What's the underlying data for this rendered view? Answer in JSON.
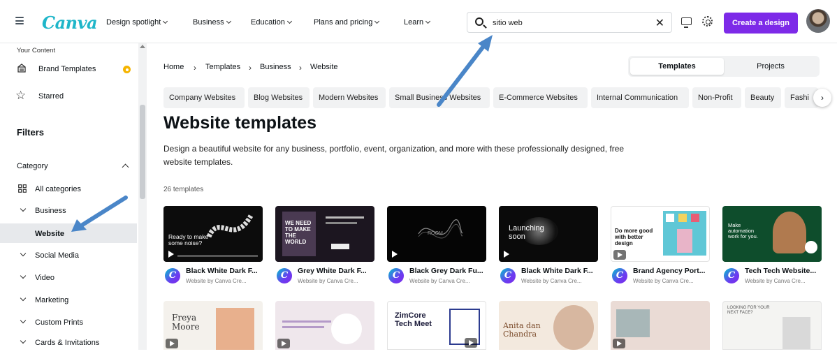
{
  "header": {
    "logo": "Canva",
    "nav": [
      "Design spotlight",
      "Business",
      "Education",
      "Plans and pricing",
      "Learn"
    ],
    "search_value": "sitio web",
    "create_label": "Create a design"
  },
  "sidebar": {
    "your_content": "Your Content",
    "brand_templates": "Brand Templates",
    "starred": "Starred",
    "filters": "Filters",
    "category": "Category",
    "all_categories": "All categories",
    "items": [
      "Business",
      "Website",
      "Social Media",
      "Video",
      "Marketing",
      "Custom Prints",
      "Cards & Invitations"
    ]
  },
  "breadcrumb": [
    "Home",
    "Templates",
    "Business",
    "Website"
  ],
  "view_toggle": {
    "templates": "Templates",
    "projects": "Projects"
  },
  "chips": [
    "Company Websites",
    "Blog Websites",
    "Modern Websites",
    "Small Business Websites",
    "E-Commerce Websites",
    "Internal Communication",
    "Non-Profit",
    "Beauty",
    "Fashi"
  ],
  "page": {
    "title": "Website templates",
    "description": "Design a beautiful website for any business, portfolio, event, organization, and more with these professionally designed, free website templates.",
    "count": "26 templates"
  },
  "cards": [
    {
      "title": "Black White Dark F...",
      "sub": "Website by Canva Cre...",
      "thumb_text": "Ready to make some noise?"
    },
    {
      "title": "Grey White Dark F...",
      "sub": "Website by Canva Cre...",
      "thumb_text": "WE NEED TO MAKE THE WORLD"
    },
    {
      "title": "Black Grey Dark Fu...",
      "sub": "Website by Canva Cre...",
      "thumb_text": "ROOM"
    },
    {
      "title": "Black White Dark F...",
      "sub": "Website by Canva Cre...",
      "thumb_text": "Launching soon"
    },
    {
      "title": "Brand Agency Port...",
      "sub": "Website by Canva Cre...",
      "thumb_text": "Do more good with better design"
    },
    {
      "title": "Tech Tech Website...",
      "sub": "Website by Canva Cre...",
      "thumb_text": "Make automation work for you."
    }
  ],
  "row2": [
    {
      "thumb_text": "Freya Moore"
    },
    {
      "thumb_text": ""
    },
    {
      "thumb_text": "ZimCore Tech Meet"
    },
    {
      "thumb_text": "Anita dan Chandra"
    },
    {
      "thumb_text": ""
    },
    {
      "thumb_text": "LOOKING FOR YOUR NEXT FACE?"
    }
  ],
  "colors": {
    "accent": "#7d2ae8",
    "logo": "#1fb6c9",
    "arrow": "#4a86c8"
  }
}
